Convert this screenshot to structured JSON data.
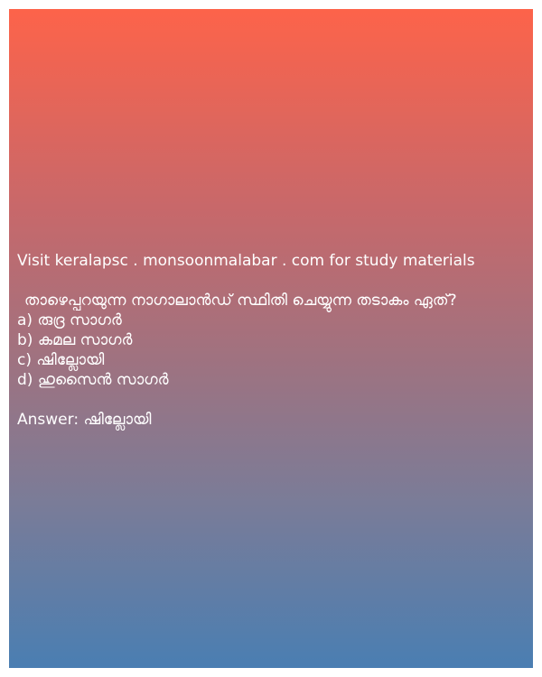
{
  "card": {
    "visit_text": "Visit keralapsc . monsoonmalabar . com for study materials",
    "question": "താഴെപ്പറയുന്ന നാഗാലാൻഡ് സ്ഥിതി ചെയ്യുന്ന തടാകം ഏത്?",
    "options": [
      "a) രുദ്ര സാഗർ",
      "b) കമല സാഗർ",
      "c) ഷില്ലോയി",
      "d) ഹുസൈൻ സാഗർ"
    ],
    "answer": "Answer: ഷില്ലോയി"
  },
  "colors": {
    "gradient_top": "#fd634a",
    "gradient_bottom": "#4a7eb2",
    "text": "#ffffff"
  }
}
